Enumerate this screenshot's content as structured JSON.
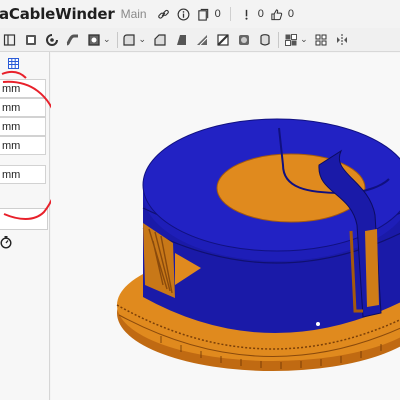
{
  "title_bar": {
    "document_title": "aCableWinder",
    "branch": "Main",
    "versions_count": "0",
    "followers_count": "0",
    "likes_count": "0"
  },
  "toolbar": {
    "icons": [
      "sketch-icon",
      "extrude-icon",
      "revolve-icon",
      "sweep-icon",
      "loft-icon",
      "fillet-icon",
      "chamfer-icon",
      "draft-icon",
      "shell-icon",
      "hole-icon",
      "thicken-icon",
      "boolean-icon",
      "split-icon",
      "pattern-icon",
      "mirror-icon",
      "variable-icon",
      "more-icon"
    ]
  },
  "parameters_panel": {
    "units": [
      "mm",
      "mm",
      "mm",
      "mm",
      "mm"
    ],
    "annotation_color": "#e8202a"
  },
  "model": {
    "primary_color": "#1a1aa8",
    "accent_color": "#e08a1e",
    "background": "#f8f8f8"
  }
}
